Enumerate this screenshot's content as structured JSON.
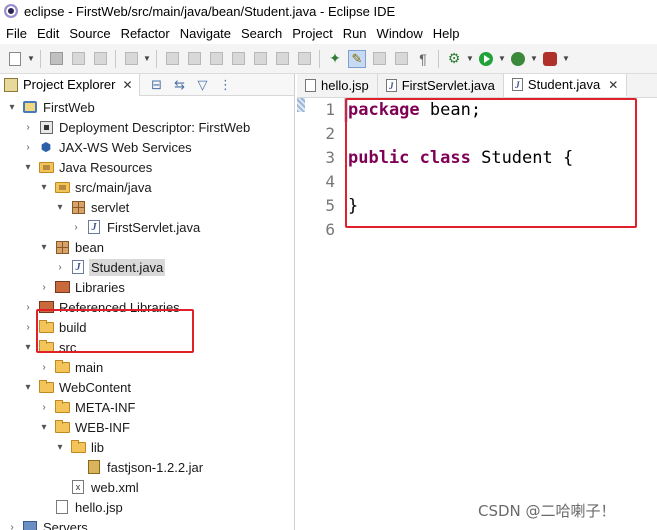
{
  "window": {
    "title": "eclipse - FirstWeb/src/main/java/bean/Student.java - Eclipse IDE",
    "icon": "eclipse-icon"
  },
  "menu": [
    "File",
    "Edit",
    "Source",
    "Refactor",
    "Navigate",
    "Search",
    "Project",
    "Run",
    "Window",
    "Help"
  ],
  "explorer": {
    "tab_label": "Project Explorer",
    "close_glyph": "✕",
    "tree": [
      {
        "label": "FirstWeb",
        "icon": "project-icon",
        "twisty": "▾",
        "indent": 0
      },
      {
        "label": "Deployment Descriptor: FirstWeb",
        "icon": "deployment-descriptor-icon",
        "twisty": "›",
        "indent": 1
      },
      {
        "label": "JAX-WS Web Services",
        "icon": "jaxws-icon",
        "twisty": "›",
        "indent": 1
      },
      {
        "label": "Java Resources",
        "icon": "java-resources-icon",
        "twisty": "▾",
        "indent": 1
      },
      {
        "label": "src/main/java",
        "icon": "source-folder-icon",
        "twisty": "▾",
        "indent": 2
      },
      {
        "label": "servlet",
        "icon": "package-icon",
        "twisty": "▾",
        "indent": 3
      },
      {
        "label": "FirstServlet.java",
        "icon": "java-file-icon",
        "twisty": "›",
        "indent": 4
      },
      {
        "label": "bean",
        "icon": "package-icon",
        "twisty": "▾",
        "indent": 2
      },
      {
        "label": "Student.java",
        "icon": "java-file-icon",
        "twisty": "›",
        "indent": 3,
        "selected": true
      },
      {
        "label": "Libraries",
        "icon": "library-icon",
        "twisty": "›",
        "indent": 2
      },
      {
        "label": "Referenced Libraries",
        "icon": "library-icon",
        "twisty": "›",
        "indent": 1
      },
      {
        "label": "build",
        "icon": "folder-icon",
        "twisty": "›",
        "indent": 1
      },
      {
        "label": "src",
        "icon": "folder-icon",
        "twisty": "▾",
        "indent": 1
      },
      {
        "label": "main",
        "icon": "folder-icon",
        "twisty": "›",
        "indent": 2
      },
      {
        "label": "WebContent",
        "icon": "folder-icon",
        "twisty": "▾",
        "indent": 1
      },
      {
        "label": "META-INF",
        "icon": "folder-icon",
        "twisty": "›",
        "indent": 2
      },
      {
        "label": "WEB-INF",
        "icon": "folder-icon",
        "twisty": "▾",
        "indent": 2
      },
      {
        "label": "lib",
        "icon": "folder-icon",
        "twisty": "▾",
        "indent": 3
      },
      {
        "label": "fastjson-1.2.2.jar",
        "icon": "jar-icon",
        "twisty": "",
        "indent": 4
      },
      {
        "label": "web.xml",
        "icon": "xml-file-icon",
        "twisty": "",
        "indent": 3
      },
      {
        "label": "hello.jsp",
        "icon": "jsp-file-icon",
        "twisty": "",
        "indent": 2
      },
      {
        "label": "Servers",
        "icon": "server-icon",
        "twisty": "›",
        "indent": 0
      }
    ]
  },
  "editor": {
    "tabs": [
      {
        "label": "hello.jsp",
        "icon": "jsp-file-icon",
        "active": false
      },
      {
        "label": "FirstServlet.java",
        "icon": "java-file-icon",
        "active": false
      },
      {
        "label": "Student.java",
        "icon": "java-file-icon",
        "active": true,
        "close": "✕"
      }
    ],
    "line_numbers": [
      "1",
      "2",
      "3",
      "4",
      "5",
      "6"
    ],
    "lines": [
      [
        {
          "t": "package",
          "k": true
        },
        {
          "t": " bean;",
          "k": false
        }
      ],
      [],
      [
        {
          "t": "public",
          "k": true
        },
        {
          "t": " ",
          "k": false
        },
        {
          "t": "class",
          "k": true
        },
        {
          "t": " Student {",
          "k": false
        }
      ],
      [],
      [
        {
          "t": "}",
          "k": false
        }
      ],
      []
    ]
  },
  "watermark": "CSDN @二哈喇子！",
  "colors": {
    "keyword": "#7f0055",
    "highlight_box": "#e0202a",
    "selection": "#d9d9d9"
  }
}
